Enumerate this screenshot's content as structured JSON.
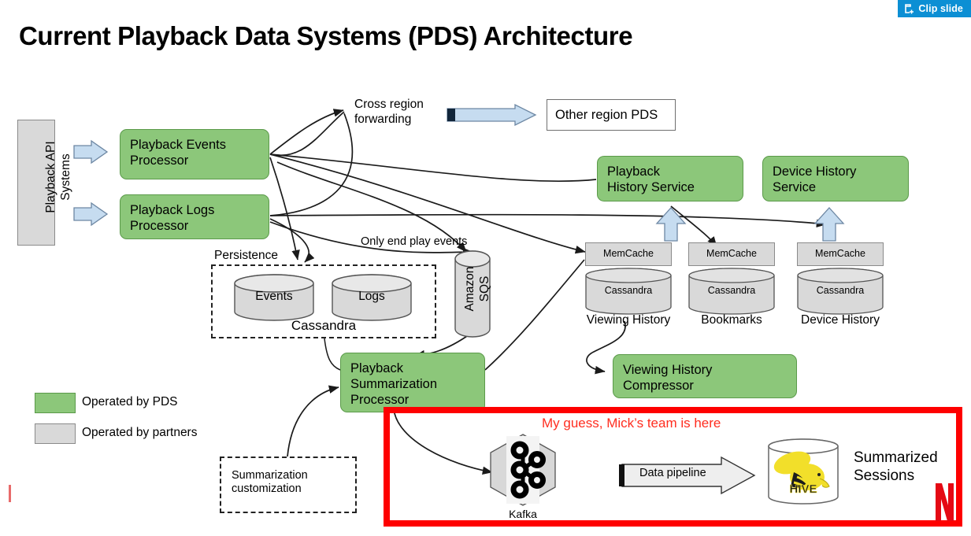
{
  "toolbar": {
    "clip_slide_label": "Clip slide",
    "clip_icon": "clip-slide-icon",
    "accent_color": "#0c8fd4"
  },
  "slide": {
    "title": "Current Playback Data Systems (PDS) Architecture",
    "background": "#ffffff"
  },
  "colors": {
    "pds_green": "#8cc77a",
    "partner_grey": "#d9d9d9",
    "arrow_blue": "#c6dcf0",
    "highlight_red": "#fe0000",
    "note_red": "#ff2d1f",
    "netflix_red": "#e50914"
  },
  "nodes": {
    "playback_api_systems": "Playback API\nSystems",
    "playback_events_processor": "Playback Events\nProcessor",
    "playback_logs_processor": "Playback Logs\nProcessor",
    "cross_region_forwarding": "Cross region\nforwarding",
    "other_region_pds": "Other region PDS",
    "playback_history_service": "Playback\nHistory Service",
    "device_history_service": "Device History\nService",
    "only_end_play_events": "Only end play events",
    "persistence": "Persistence",
    "events_store": "Events",
    "logs_store": "Logs",
    "cassandra_group": "Cassandra",
    "amazon_sqs": "Amazon\nSQS",
    "playback_summarization_processor": "Playback\nSummarization\nProcessor",
    "summarization_customization": "Summarization\ncustomization",
    "viewing_history_compressor": "Viewing History\nCompressor",
    "kafka": "Kafka",
    "data_pipeline": "Data pipeline",
    "summarized_sessions": "Summarized\nSessions"
  },
  "stores": [
    {
      "cache": "MemCache",
      "db": "Cassandra",
      "caption": "Viewing History"
    },
    {
      "cache": "MemCache",
      "db": "Cassandra",
      "caption": "Bookmarks"
    },
    {
      "cache": "MemCache",
      "db": "Cassandra",
      "caption": "Device History"
    }
  ],
  "legend": [
    {
      "swatch": "#8cc77a",
      "label": "Operated by PDS"
    },
    {
      "swatch": "#d9d9d9",
      "label": "Operated by partners"
    }
  ],
  "annotation": {
    "note": "My guess, Mick’s team is here"
  },
  "branding": {
    "netflix_logo": "netflix-n-logo"
  }
}
